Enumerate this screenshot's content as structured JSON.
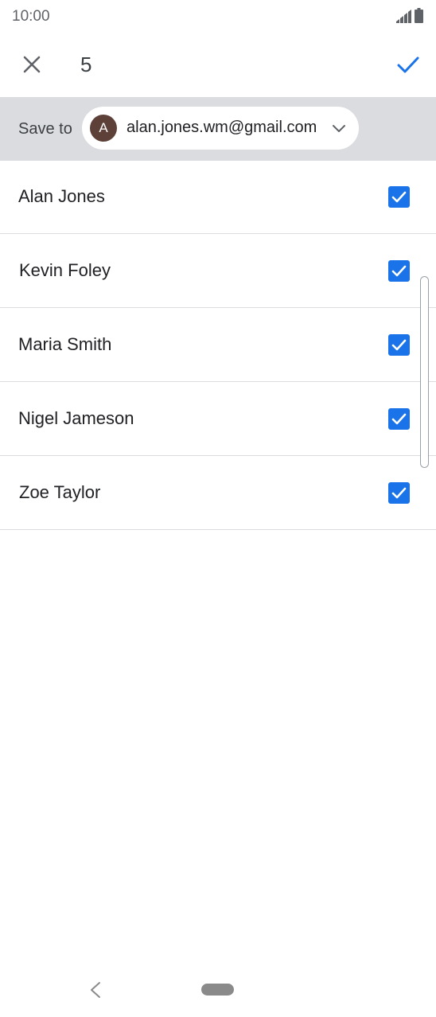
{
  "status_bar": {
    "time": "10:00",
    "icons": [
      "signal-icon",
      "battery-icon"
    ]
  },
  "action_bar": {
    "close_icon": "close-icon",
    "selected_count": "5",
    "confirm_icon": "check-icon"
  },
  "save_to": {
    "label": "Save to",
    "account": {
      "avatar_letter": "A",
      "avatar_color": "#5d4037",
      "email": "alan.jones.wm@gmail.com"
    },
    "dropdown_icon": "chevron-down-icon"
  },
  "contacts": [
    {
      "name": "Alan Jones",
      "checked": true
    },
    {
      "name": "Kevin Foley",
      "checked": true
    },
    {
      "name": "Maria Smith",
      "checked": true
    },
    {
      "name": "Nigel Jameson",
      "checked": true
    },
    {
      "name": "Zoe Taylor",
      "checked": true
    }
  ],
  "colors": {
    "accent": "#1a73e8",
    "save_bar_bg": "#dadce0",
    "divider": "#dadce0"
  },
  "nav_bar": {
    "icons": [
      "back-icon",
      "home-pill"
    ]
  }
}
